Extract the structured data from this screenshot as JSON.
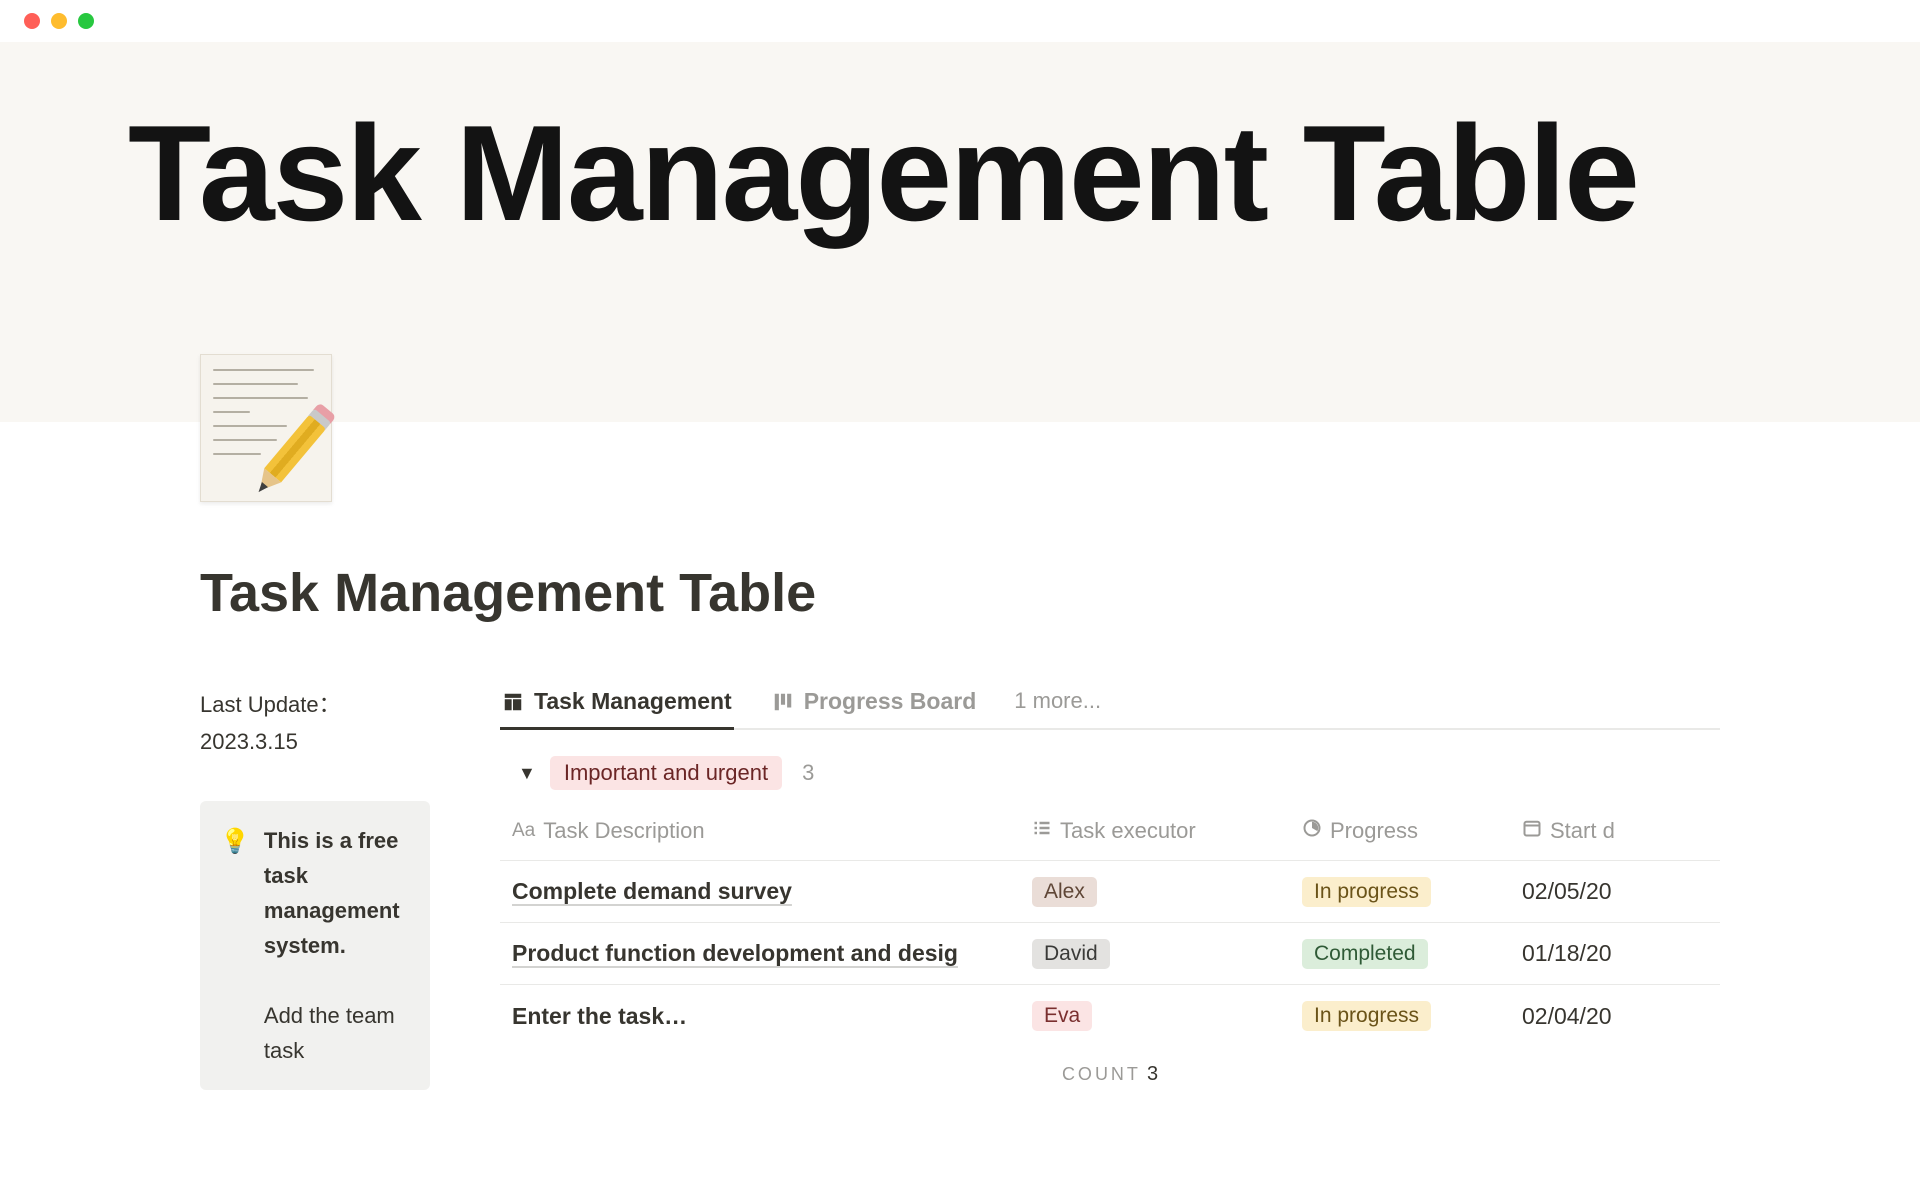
{
  "hero_title": "Task Management Table",
  "page_title": "Task Management Table",
  "last_update_label": "Last Update：",
  "last_update_value": "2023.3.15",
  "callout": {
    "icon": "💡",
    "bold_text": "This is a free task management system.",
    "continued": "Add the team task"
  },
  "view_tabs": {
    "active": {
      "label": "Task Management"
    },
    "secondary": {
      "label": "Progress Board"
    },
    "more": "1 more..."
  },
  "group": {
    "label": "Important and urgent",
    "count": "3"
  },
  "columns": {
    "description": "Task Description",
    "executor": "Task executor",
    "progress": "Progress",
    "start_date": "Start d"
  },
  "rows": [
    {
      "description": "Complete demand survey",
      "executor": "Alex",
      "executor_tag": "tag-alex",
      "progress": "In progress",
      "progress_tag": "tag-inprog",
      "start_date": "02/05/20"
    },
    {
      "description": "Product function development and desig",
      "executor": "David",
      "executor_tag": "tag-david",
      "progress": "Completed",
      "progress_tag": "tag-completed",
      "start_date": "01/18/20"
    },
    {
      "description": "Enter the task…",
      "executor": "Eva",
      "executor_tag": "tag-eva",
      "progress": "In progress",
      "progress_tag": "tag-inprog",
      "start_date": "02/04/20"
    }
  ],
  "footer": {
    "label": "COUNT",
    "value": "3"
  }
}
